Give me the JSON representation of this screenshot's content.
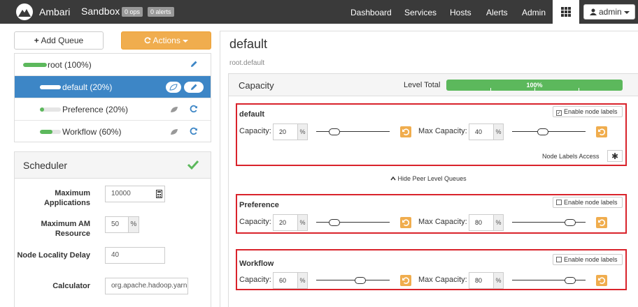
{
  "navbar": {
    "brand": "Ambari",
    "cluster": "Sandbox",
    "ops_badge": "0 ops",
    "alerts_badge": "0 alerts",
    "links": [
      "Dashboard",
      "Services",
      "Hosts",
      "Alerts",
      "Admin"
    ],
    "user": "admin"
  },
  "queue_actions": {
    "add_queue": "Add Queue",
    "actions": "Actions"
  },
  "queue_tree": [
    {
      "label": "root (100%)",
      "capacity": 100
    },
    {
      "label": "default (20%)",
      "capacity": 20,
      "selected": true
    },
    {
      "label": "Preference (20%)",
      "capacity": 20
    },
    {
      "label": "Workflow (60%)",
      "capacity": 60
    }
  ],
  "scheduler": {
    "title": "Scheduler",
    "fields": [
      {
        "label": "Maximum Applications",
        "value": "10000"
      },
      {
        "label": "Maximum AM Resource",
        "value": "50",
        "unit": "%"
      },
      {
        "label": "Node Locality Delay",
        "value": "40"
      },
      {
        "label": "Calculator",
        "value": "org.apache.hadoop.yarn"
      }
    ]
  },
  "queue_detail": {
    "title": "default",
    "path": "root.default",
    "capacity_title": "Capacity",
    "level_total_label": "Level Total",
    "level_total_value": "100%",
    "level_total_fraction": 1.0,
    "capacity_label": "Capacity:",
    "max_capacity_label": "Max Capacity:",
    "percent_unit": "%",
    "node_labels_access": "Node Labels Access",
    "hide_peer": "Hide Peer Level Queues",
    "queues": [
      {
        "name": "default",
        "capacity": "20",
        "max_capacity": "40",
        "capacity_fraction": 0.2,
        "max_fraction": 0.4,
        "node_label_btn": "Enable node labels",
        "node_labels_checked": true
      },
      {
        "name": "Preference",
        "capacity": "20",
        "max_capacity": "80",
        "capacity_fraction": 0.2,
        "max_fraction": 0.8,
        "node_label_btn": "Enable node labels",
        "node_labels_checked": false
      },
      {
        "name": "Workflow",
        "capacity": "60",
        "max_capacity": "80",
        "capacity_fraction": 0.6,
        "max_fraction": 0.8,
        "node_label_btn": "Enable node labels",
        "node_labels_checked": false
      }
    ]
  },
  "colors": {
    "navbar": "#3a3a3a",
    "accent_orange": "#f0ad4e",
    "selected_blue": "#3d86c6",
    "progress_green": "#5cb85c",
    "highlight_red": "#d9232b"
  }
}
